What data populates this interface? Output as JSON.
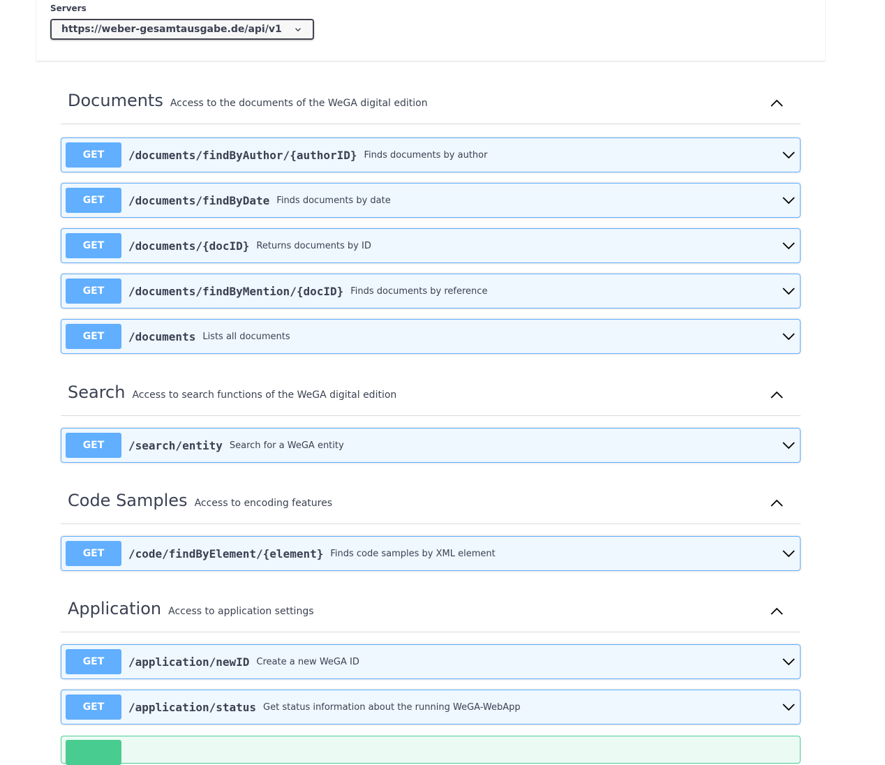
{
  "servers": {
    "label": "Servers",
    "selected": "https://weber-gesamtausgabe.de/api/v1"
  },
  "tags": [
    {
      "name": "Documents",
      "description": "Access to the documents of the WeGA digital edition",
      "operations": [
        {
          "method": "GET",
          "path": "/documents/findByAuthor/{authorID}",
          "summary": "Finds documents by author"
        },
        {
          "method": "GET",
          "path": "/documents/findByDate",
          "summary": "Finds documents by date"
        },
        {
          "method": "GET",
          "path": "/documents/{docID}",
          "summary": "Returns documents by ID"
        },
        {
          "method": "GET",
          "path": "/documents/findByMention/{docID}",
          "summary": "Finds documents by reference"
        },
        {
          "method": "GET",
          "path": "/documents",
          "summary": "Lists all documents"
        }
      ]
    },
    {
      "name": "Search",
      "description": "Access to search functions of the WeGA digital edition",
      "operations": [
        {
          "method": "GET",
          "path": "/search/entity",
          "summary": "Search for a WeGA entity"
        }
      ]
    },
    {
      "name": "Code Samples",
      "description": "Access to encoding features",
      "operations": [
        {
          "method": "GET",
          "path": "/code/findByElement/{element}",
          "summary": "Finds code samples by XML element"
        }
      ]
    },
    {
      "name": "Application",
      "description": "Access to application settings",
      "operations": [
        {
          "method": "GET",
          "path": "/application/newID",
          "summary": "Create a new WeGA ID"
        },
        {
          "method": "GET",
          "path": "/application/status",
          "summary": "Get status information about the running WeGA-WebApp"
        }
      ]
    }
  ],
  "colors": {
    "get": "#61affe",
    "post": "#49cc90",
    "text": "#3b4151"
  }
}
